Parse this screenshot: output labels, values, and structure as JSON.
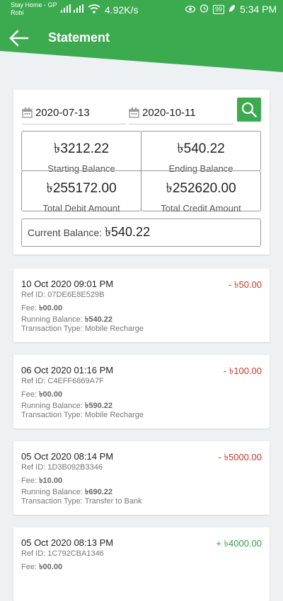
{
  "status_bar": {
    "carrier_line1": "Stay Home - GP",
    "carrier_line2": "Robi",
    "speed": "4.92K/s",
    "battery": "99",
    "time": "5:34 PM"
  },
  "header": {
    "title": "Statement"
  },
  "filter": {
    "from_date": "2020-07-13",
    "to_date": "2020-10-11",
    "starting_balance_label": "Starting Balance",
    "starting_balance": "৳3212.22",
    "ending_balance_label": "Ending Balance",
    "ending_balance": "৳540.22",
    "total_debit_label": "Total Debit Amount",
    "total_debit": "৳255172.00",
    "total_credit_label": "Total Credit Amount",
    "total_credit": "৳252620.00",
    "current_balance_label": "Current Balance:",
    "current_balance": "৳540.22"
  },
  "labels": {
    "ref": "Ref ID:",
    "fee": "Fee:",
    "running": "Running Balance:",
    "type": "Transaction Type:"
  },
  "transactions": [
    {
      "datetime": "10 Oct 2020 09:01 PM",
      "amount": "- ৳50.00",
      "direction": "debit",
      "ref_id": "07DE6E8E529B",
      "fee": "৳00.00",
      "running_balance": "৳540.22",
      "type": "Mobile Recharge"
    },
    {
      "datetime": "06 Oct 2020 01:16 PM",
      "amount": "- ৳100.00",
      "direction": "debit",
      "ref_id": "C4EFF6869A7F",
      "fee": "৳00.00",
      "running_balance": "৳590.22",
      "type": "Mobile Recharge"
    },
    {
      "datetime": "05 Oct 2020 08:14 PM",
      "amount": "- ৳5000.00",
      "direction": "debit",
      "ref_id": "1D3B092B3346",
      "fee": "৳10.00",
      "running_balance": "৳690.22",
      "type": "Transfer to Bank"
    },
    {
      "datetime": "05 Oct 2020 08:13 PM",
      "amount": "+ ৳4000.00",
      "direction": "credit",
      "ref_id": "1C792CBA1346",
      "fee": "৳00.00",
      "running_balance": "",
      "type": ""
    }
  ],
  "colors": {
    "accent": "#3caa4f",
    "debit": "#c0392b",
    "credit": "#2e9e4f"
  }
}
